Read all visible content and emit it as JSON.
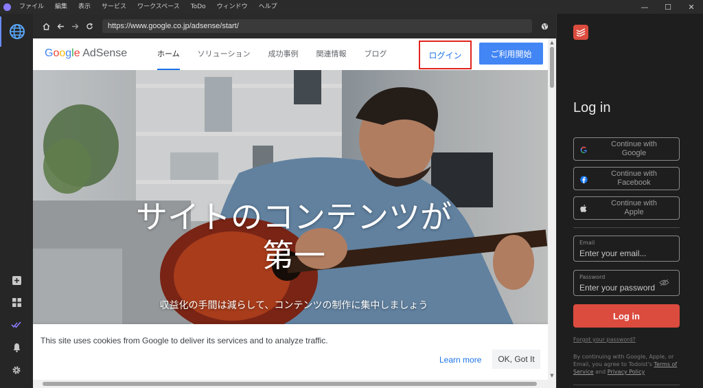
{
  "titlebar": {
    "menu": [
      "ファイル",
      "編集",
      "表示",
      "サービス",
      "ワークスペース",
      "ToDo",
      "ウィンドウ",
      "ヘルプ"
    ],
    "controls": [
      "—",
      "☐",
      "✕"
    ]
  },
  "toolbar": {
    "url": "https://www.google.co.jp/adsense/start/"
  },
  "site": {
    "brand_google": [
      "G",
      "o",
      "o",
      "g",
      "l",
      "e"
    ],
    "brand_product": "AdSense",
    "nav": [
      "ホーム",
      "ソリューション",
      "成功事例",
      "関連情報",
      "ブログ"
    ],
    "login": "ログイン",
    "signup": "ご利用開始",
    "hero_title_line1": "サイトのコンテンツが",
    "hero_title_line2": "第一",
    "hero_subtitle": "収益化の手間は減らして、コンテンツの制作に集中しましょう",
    "cookie_text": "This site uses cookies from Google to deliver its services and to analyze traffic.",
    "learn_more": "Learn more",
    "got_it": "OK, Got It"
  },
  "todoist": {
    "title": "Log in",
    "google_line1": "Continue with",
    "google_line2": "Google",
    "facebook_line1": "Continue with",
    "facebook_line2": "Facebook",
    "apple_line1": "Continue with",
    "apple_line2": "Apple",
    "email_label": "Email",
    "email_placeholder": "Enter your email...",
    "password_label": "Password",
    "password_placeholder": "Enter your password",
    "login_button": "Log in",
    "forgot": "Forgot your password?",
    "terms_prefix": "By continuing with Google, Apple, or Email, you agree to Todoist's",
    "terms_link": "Terms of Service",
    "terms_and": "and",
    "privacy_link": "Privacy Policy",
    "brand_color": "#db4c3f"
  }
}
